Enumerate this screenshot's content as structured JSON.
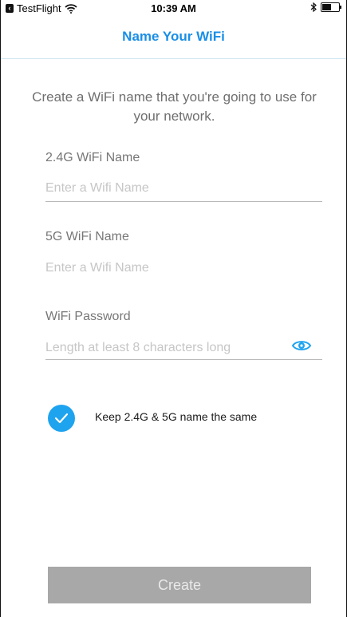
{
  "status_bar": {
    "app_name": "TestFlight",
    "time": "10:39 AM",
    "back_icon": "back-app-icon",
    "wifi_icon": "wifi-icon",
    "bluetooth_icon": "bluetooth-icon",
    "battery_icon": "battery-icon"
  },
  "nav": {
    "title": "Name Your WiFi",
    "title_color": "#1a8ee6"
  },
  "intro_text": "Create a WiFi name that you're going to use for your network.",
  "fields": {
    "wifi_24": {
      "label": "2.4G WiFi Name",
      "placeholder": "Enter a Wifi Name",
      "value": ""
    },
    "wifi_5": {
      "label": "5G WiFi Name",
      "placeholder": "Enter a Wifi Name",
      "value": ""
    },
    "password": {
      "label": "WiFi Password",
      "placeholder": "Length at least 8 characters long",
      "value": "",
      "toggle_icon": "eye-icon"
    }
  },
  "same_name": {
    "checked": true,
    "label": "Keep 2.4G & 5G name the same",
    "icon": "checkmark-icon",
    "accent_color": "#1ea3ef"
  },
  "create_button": {
    "label": "Create",
    "enabled": false,
    "color": "#a8a8a8"
  }
}
